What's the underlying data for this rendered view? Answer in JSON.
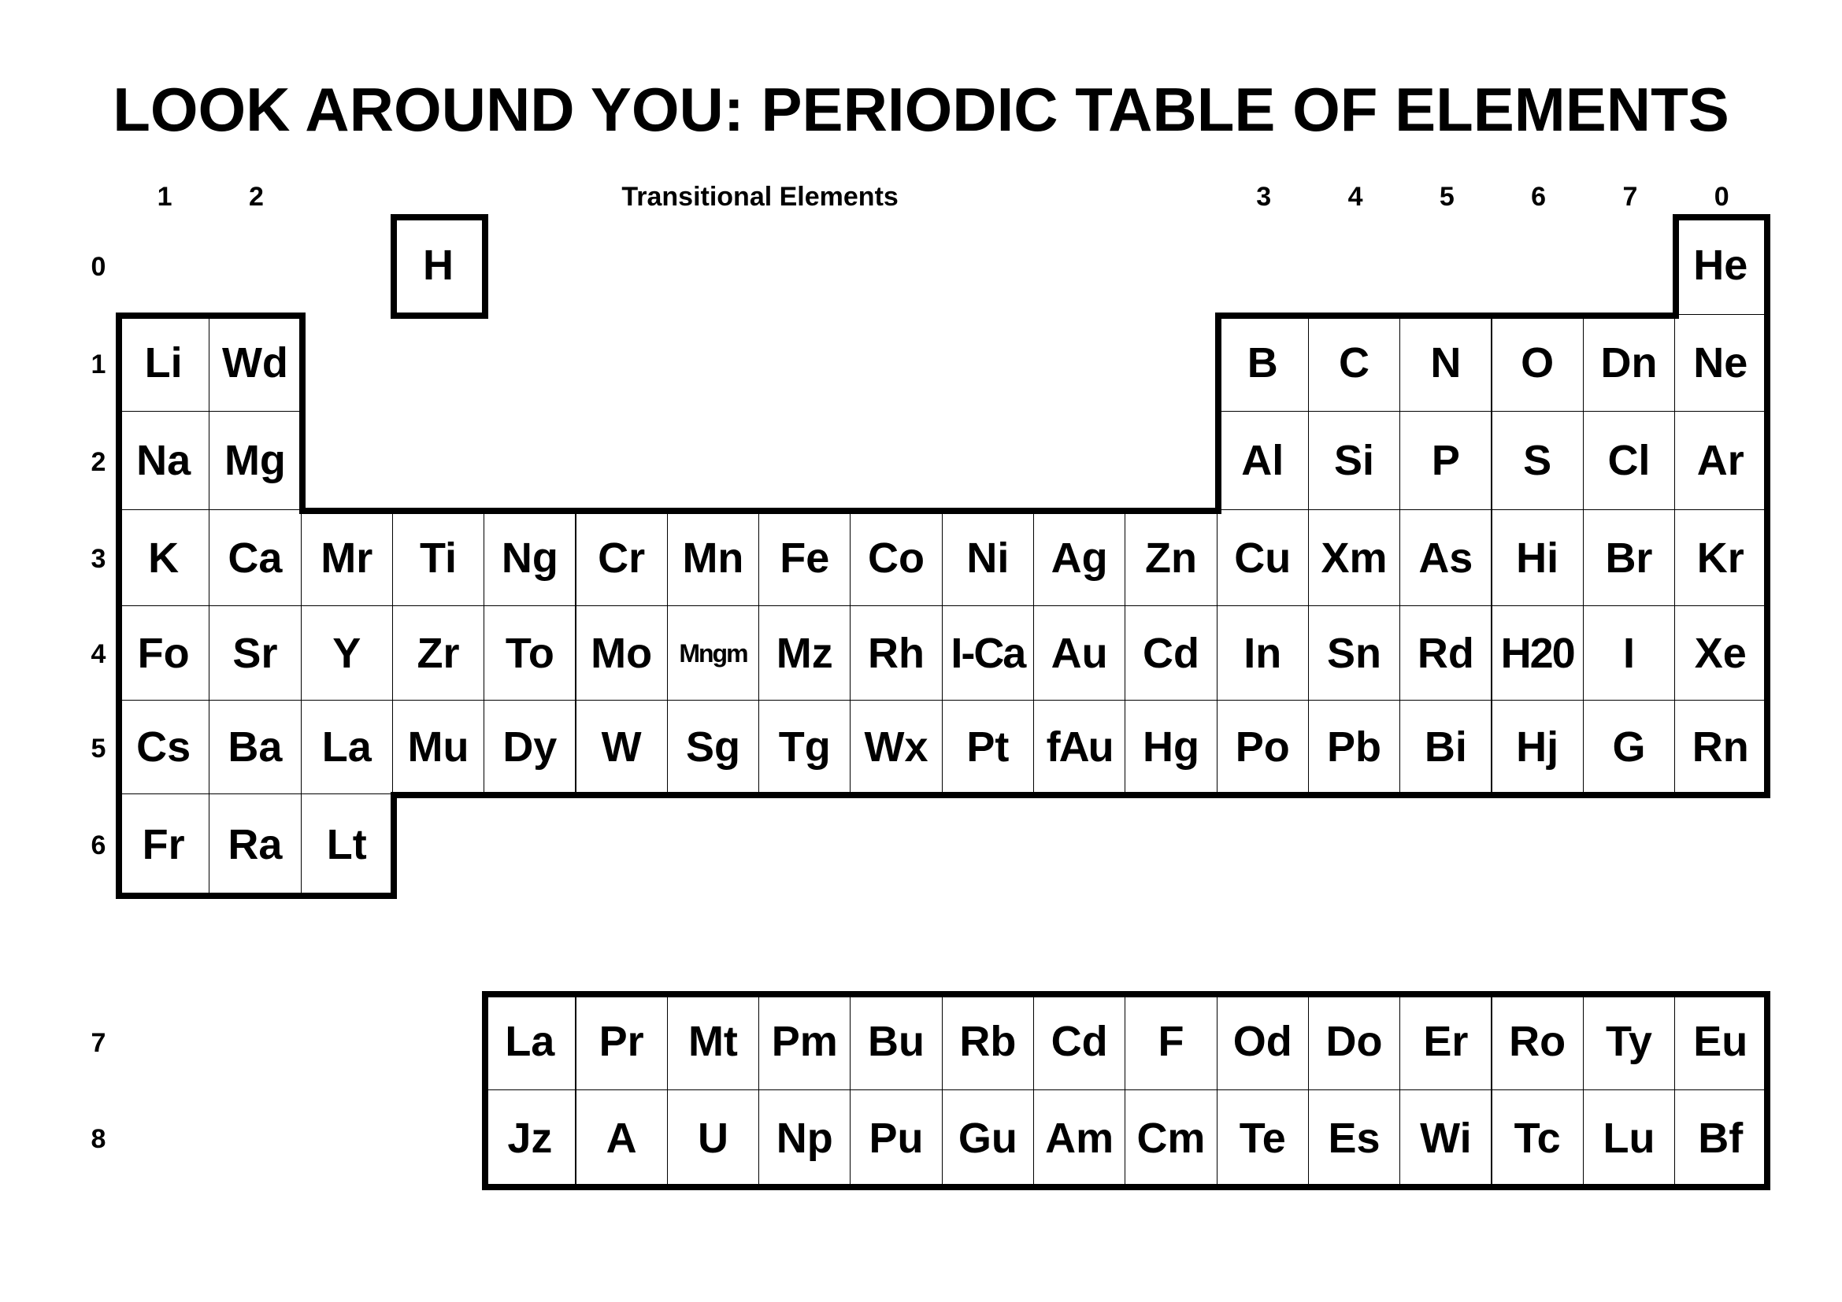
{
  "title": "LOOK AROUND YOU: PERIODIC TABLE OF ELEMENTS",
  "group_labels": [
    {
      "col": 0,
      "text": "1"
    },
    {
      "col": 1,
      "text": "2"
    },
    {
      "col": 12,
      "text": "3"
    },
    {
      "col": 13,
      "text": "4"
    },
    {
      "col": 14,
      "text": "5"
    },
    {
      "col": 15,
      "text": "6"
    },
    {
      "col": 16,
      "text": "7"
    },
    {
      "col": 17,
      "text": "0"
    }
  ],
  "transitional_label": "Transitional Elements",
  "period_labels": [
    "0",
    "1",
    "2",
    "3",
    "4",
    "5",
    "6",
    "7",
    "8"
  ],
  "main_table": {
    "row0": [
      {
        "col": 3,
        "symbol": "H"
      },
      {
        "col": 17,
        "symbol": "He"
      }
    ],
    "row1": [
      {
        "col": 0,
        "symbol": "Li"
      },
      {
        "col": 1,
        "symbol": "Wd"
      },
      {
        "col": 12,
        "symbol": "B"
      },
      {
        "col": 13,
        "symbol": "C"
      },
      {
        "col": 14,
        "symbol": "N"
      },
      {
        "col": 15,
        "symbol": "O"
      },
      {
        "col": 16,
        "symbol": "Dn"
      },
      {
        "col": 17,
        "symbol": "Ne"
      }
    ],
    "row2": [
      {
        "col": 0,
        "symbol": "Na"
      },
      {
        "col": 1,
        "symbol": "Mg"
      },
      {
        "col": 12,
        "symbol": "Al"
      },
      {
        "col": 13,
        "symbol": "Si"
      },
      {
        "col": 14,
        "symbol": "P"
      },
      {
        "col": 15,
        "symbol": "S"
      },
      {
        "col": 16,
        "symbol": "Cl"
      },
      {
        "col": 17,
        "symbol": "Ar"
      }
    ],
    "row3": [
      "K",
      "Ca",
      "Mr",
      "Ti",
      "Ng",
      "Cr",
      "Mn",
      "Fe",
      "Co",
      "Ni",
      "Ag",
      "Zn",
      "Cu",
      "Xm",
      "As",
      "Hi",
      "Br",
      "Kr"
    ],
    "row4": [
      "Fo",
      "Sr",
      "Y",
      "Zr",
      "To",
      "Mo",
      "Mngm",
      "Mz",
      "Rh",
      "I-Ca",
      "Au",
      "Cd",
      "In",
      "Sn",
      "Rd",
      "H20",
      "I",
      "Xe"
    ],
    "row5": [
      "Cs",
      "Ba",
      "La",
      "Mu",
      "Dy",
      "W",
      "Sg",
      "Tg",
      "Wx",
      "Pt",
      "fAu",
      "Hg",
      "Po",
      "Pb",
      "Bi",
      "Hj",
      "G",
      "Rn"
    ],
    "row6": [
      "Fr",
      "Ra",
      "Lt"
    ]
  },
  "lower_table": {
    "row7": [
      "La",
      "Pr",
      "Mt",
      "Pm",
      "Bu",
      "Rb",
      "Cd",
      "F",
      "Od",
      "Do",
      "Er",
      "Ro",
      "Ty",
      "Eu"
    ],
    "row8": [
      "Jz",
      "A",
      "U",
      "Np",
      "Pu",
      "Gu",
      "Am",
      "Cm",
      "Te",
      "Es",
      "Wi",
      "Tc",
      "Lu",
      "Bf"
    ]
  }
}
